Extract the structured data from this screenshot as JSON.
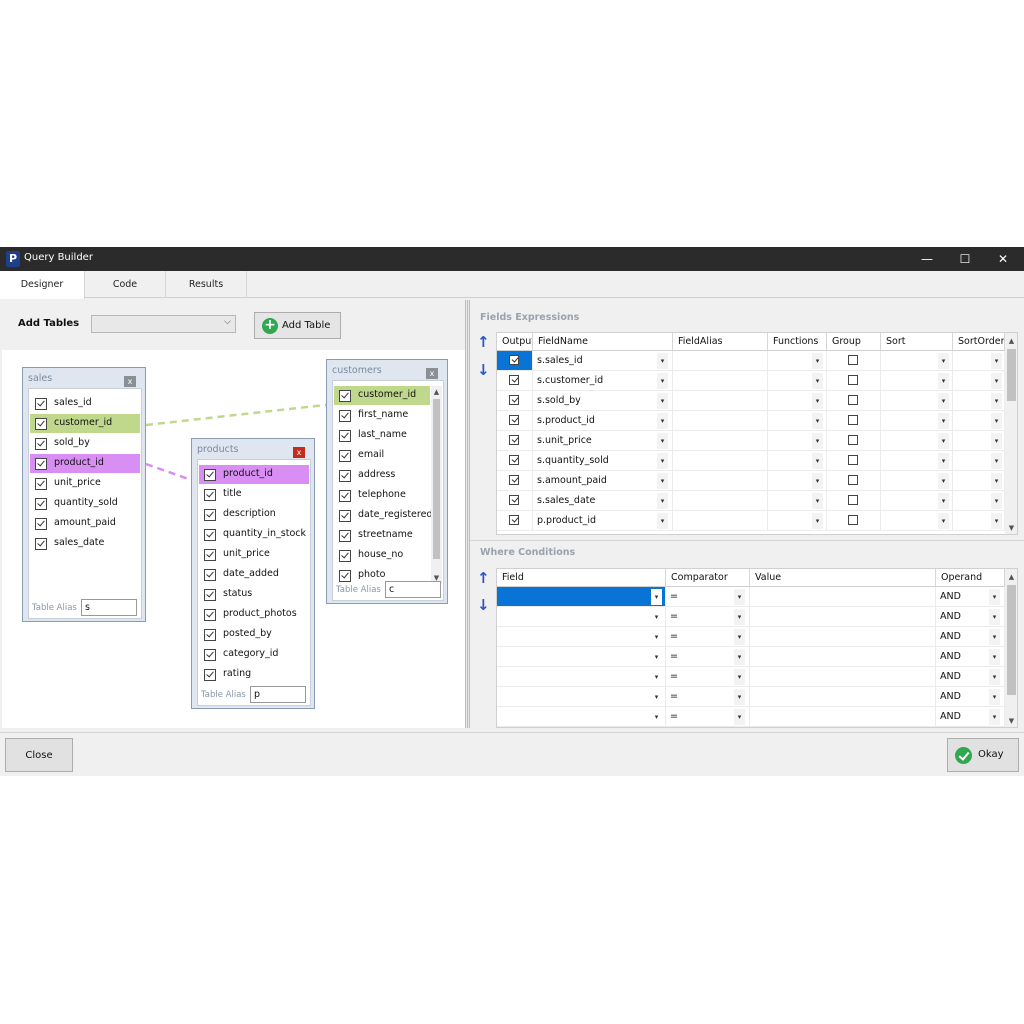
{
  "window": {
    "title": "Query Builder",
    "logo": "P",
    "minimize": "—",
    "maximize": "☐",
    "close": "✕"
  },
  "tabs": [
    {
      "label": "Designer",
      "active": true
    },
    {
      "label": "Code"
    },
    {
      "label": "Results"
    }
  ],
  "toolbar": {
    "add_tables_label": "Add Tables",
    "add_table_button": "Add Table",
    "plus_glyph": "+"
  },
  "tables": {
    "sales": {
      "title": "sales",
      "close": "x",
      "alias_label": "Table Alias",
      "alias": "s",
      "fields": [
        "sales_id",
        "customer_id",
        "sold_by",
        "product_id",
        "unit_price",
        "quantity_sold",
        "amount_paid",
        "sales_date"
      ]
    },
    "products": {
      "title": "products",
      "close": "x",
      "alias_label": "Table Alias",
      "alias": "p",
      "fields": [
        "product_id",
        "title",
        "description",
        "quantity_in_stock",
        "unit_price",
        "date_added",
        "status",
        "product_photos",
        "posted_by",
        "category_id",
        "rating"
      ]
    },
    "customers": {
      "title": "customers",
      "close": "x",
      "alias_label": "Table Alias",
      "alias": "c",
      "fields": [
        "customer_id",
        "first_name",
        "last_name",
        "email",
        "address",
        "telephone",
        "date_registered",
        "streetname",
        "house_no",
        "photo"
      ]
    }
  },
  "fields_expressions": {
    "title": "Fields Expressions",
    "columns": [
      "Output",
      "FieldName",
      "FieldAlias",
      "Functions",
      "Group",
      "Sort",
      "SortOrder"
    ],
    "rows": [
      {
        "field": "s.sales_id"
      },
      {
        "field": "s.customer_id"
      },
      {
        "field": "s.sold_by"
      },
      {
        "field": "s.product_id"
      },
      {
        "field": "s.unit_price"
      },
      {
        "field": "s.quantity_sold"
      },
      {
        "field": "s.amount_paid"
      },
      {
        "field": "s.sales_date"
      },
      {
        "field": "p.product_id"
      }
    ]
  },
  "where_conditions": {
    "title": "Where Conditions",
    "columns": [
      "Field",
      "Comparator",
      "Value",
      "Operand"
    ],
    "rows": [
      {
        "comparator": "=",
        "operand": "AND"
      },
      {
        "comparator": "=",
        "operand": "AND"
      },
      {
        "comparator": "=",
        "operand": "AND"
      },
      {
        "comparator": "=",
        "operand": "AND"
      },
      {
        "comparator": "=",
        "operand": "AND"
      },
      {
        "comparator": "=",
        "operand": "AND"
      },
      {
        "comparator": "=",
        "operand": "AND"
      }
    ]
  },
  "footer": {
    "close_button": "Close",
    "okay_button": "Okay"
  },
  "colors": {
    "join_customer": "#bfd88c",
    "join_product": "#d88ef3",
    "accent": "#0a73d6"
  }
}
